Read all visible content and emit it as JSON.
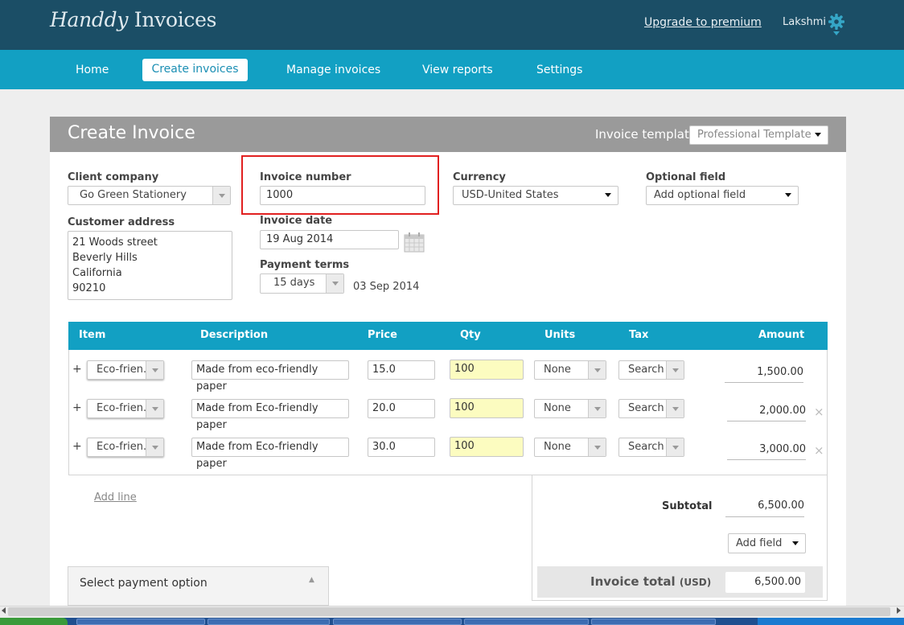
{
  "app": {
    "logo_script": "Handdy",
    "logo_rest": " Invoices",
    "upgrade_link": "Upgrade to premium",
    "username": "Lakshmi"
  },
  "nav": {
    "home": "Home",
    "create": "Create invoices",
    "manage": "Manage invoices",
    "reports": "View reports",
    "settings": "Settings",
    "active": "Create invoices"
  },
  "card": {
    "title": "Create Invoice",
    "template_label": "Invoice template",
    "template_value": "Professional Template"
  },
  "form": {
    "client_company_label": "Client company",
    "client_company_value": "Go Green Stationery",
    "customer_address_label": "Customer address",
    "customer_address_lines": [
      "21 Woods street",
      "Beverly Hills",
      "California",
      "90210"
    ],
    "invoice_number_label": "Invoice number",
    "invoice_number_value": "1000",
    "invoice_date_label": "Invoice date",
    "invoice_date_value": "19 Aug 2014",
    "payment_terms_label": "Payment terms",
    "payment_terms_value": "15 days",
    "due_date": "03 Sep 2014",
    "currency_label": "Currency",
    "currency_value": "USD-United States",
    "optional_field_label": "Optional field",
    "optional_field_value": "Add optional field"
  },
  "table": {
    "headers": {
      "item": "Item",
      "description": "Description",
      "price": "Price",
      "qty": "Qty",
      "units": "Units",
      "tax": "Tax",
      "amount": "Amount"
    },
    "rows": [
      {
        "plus": "+",
        "item": "Eco-frien.",
        "description": "Made from eco-friendly paper",
        "price": "15.0",
        "qty": "100",
        "units": "None",
        "tax": "Search",
        "amount": "1,500.00",
        "remove": ""
      },
      {
        "plus": "+",
        "item": "Eco-frien.",
        "description": "Made from Eco-friendly paper",
        "price": "20.0",
        "qty": "100",
        "units": "None",
        "tax": "Search",
        "amount": "2,000.00",
        "remove": "×"
      },
      {
        "plus": "+",
        "item": "Eco-frien.",
        "description": "Made from Eco-friendly paper",
        "price": "30.0",
        "qty": "100",
        "units": "None",
        "tax": "Search",
        "amount": "3,000.00",
        "remove": "×"
      }
    ]
  },
  "add_line": "Add line",
  "totals": {
    "subtotal_label": "Subtotal",
    "subtotal_value": "6,500.00",
    "add_field": "Add field",
    "total_label": "Invoice total",
    "total_currency": "(USD)",
    "total_value": "6,500.00"
  },
  "payment": {
    "label": "Select payment option"
  },
  "colors": {
    "topbar": "#1b4e66",
    "navbar": "#12a0c3",
    "highlight_box": "#e12020",
    "qty_fill": "#fcfcc0"
  }
}
